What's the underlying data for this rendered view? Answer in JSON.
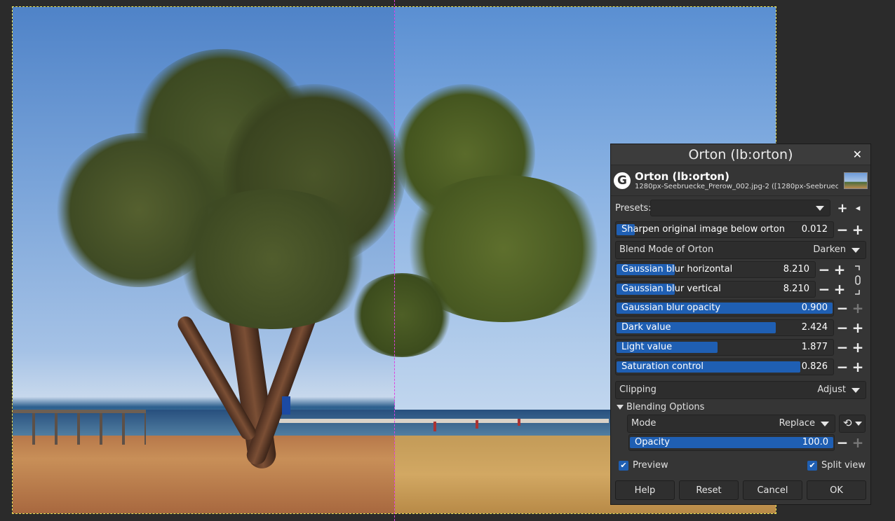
{
  "dialog": {
    "title": "Orton (lb:orton)",
    "header_title": "Orton (lb:orton)",
    "header_subtitle": "1280px-Seebruecke_Prerow_002.jpg-2 ([1280px-Seebrueck..."
  },
  "presets": {
    "label": "Presets:",
    "value": ""
  },
  "params": {
    "sharpen": {
      "label": "Sharpen original image below orton",
      "value": "0.012",
      "fill": 0.09
    },
    "blend_mode": {
      "label": "Blend Mode of Orton",
      "value": "Darken"
    },
    "blur_h": {
      "label": "Gaussian blur horizontal",
      "value": "8.210",
      "fill": 0.3
    },
    "blur_v": {
      "label": "Gaussian blur vertical",
      "value": "8.210",
      "fill": 0.3
    },
    "blur_opacity": {
      "label": "Gaussian blur opacity",
      "value": "0.900",
      "fill": 1.0
    },
    "dark": {
      "label": "Dark value",
      "value": "2.424",
      "fill": 0.74
    },
    "light": {
      "label": "Light value",
      "value": "1.877",
      "fill": 0.47
    },
    "saturation": {
      "label": "Saturation control",
      "value": "0.826",
      "fill": 0.85
    }
  },
  "clipping": {
    "label": "Clipping",
    "value": "Adjust"
  },
  "blending": {
    "title": "Blending Options",
    "mode_label": "Mode",
    "mode_value": "Replace",
    "opacity_label": "Opacity",
    "opacity_value": "100.0",
    "opacity_fill": 1.0
  },
  "checks": {
    "preview": "Preview",
    "split_view": "Split view"
  },
  "buttons": {
    "help": "Help",
    "reset": "Reset",
    "cancel": "Cancel",
    "ok": "OK"
  },
  "icons": {
    "close": "close-icon",
    "add_preset": "plus-icon",
    "manage_presets": "preset-menu-icon",
    "reset_mode": "reset-arrow-icon",
    "chain": "chain-link-icon"
  }
}
